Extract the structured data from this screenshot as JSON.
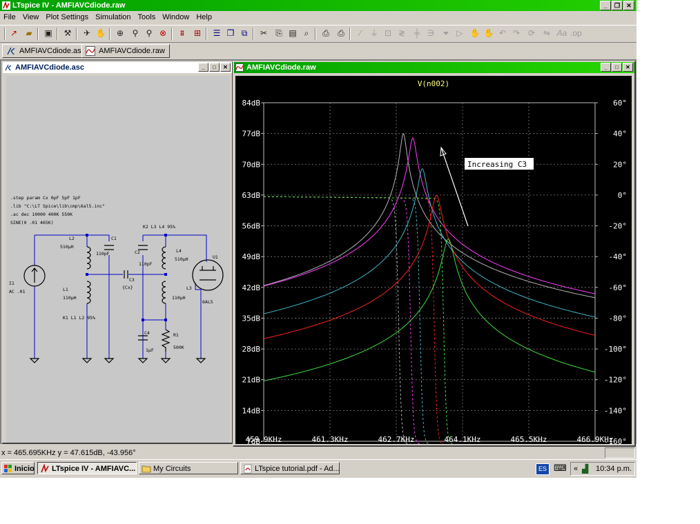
{
  "app": {
    "title": "LTspice IV - AMFIAVCdiode.raw",
    "window_controls": [
      "_",
      "❐",
      "✕"
    ]
  },
  "menu": [
    "File",
    "View",
    "Plot Settings",
    "Simulation",
    "Tools",
    "Window",
    "Help"
  ],
  "toolbar_icons": [
    "new-schematic-icon",
    "open-icon",
    "save-icon",
    "hammer-icon",
    "run-icon",
    "halt-icon",
    "zoom-area-icon",
    "zoom-in-icon",
    "zoom-out-icon",
    "zoom-cancel-icon",
    "autorange-icon",
    "grid-icon",
    "tile-horizontal-icon",
    "cascade-icon",
    "close-windows-icon",
    "cut-icon",
    "copy-icon",
    "paste-icon",
    "find-icon",
    "print-icon",
    "print-setup-icon",
    "wire-icon",
    "ground-icon",
    "label-icon",
    "resistor-icon",
    "capacitor-icon",
    "inductor-icon",
    "diode-icon",
    "component-icon",
    "move-icon",
    "drag-icon",
    "undo-icon",
    "redo-icon",
    "rotate-icon",
    "mirror-icon",
    "text-icon",
    "spice-directive-icon"
  ],
  "doc_tabs": [
    {
      "label": "AMFIAVCdiode.asc",
      "icon": "schematic-icon"
    },
    {
      "label": "AMFIAVCdiode.raw",
      "icon": "waveform-icon"
    }
  ],
  "schematic": {
    "title": "AMFIAVCdiode.asc",
    "directives": [
      ".step param Cx 0pF 5pF 1pF",
      ".lib \"C:\\LT Spice\\lib\\cmp\\6al5.inc\"",
      ".ac dec 10000 400K 550K",
      "SINE(0 .01 465K)"
    ],
    "labels": {
      "i1": "I1",
      "i1_val": "AC .01",
      "l2": "L2",
      "l2_val": "510µH",
      "c1": "C1",
      "c1_val": "110pF",
      "l1": "L1",
      "l1_val": "110µH",
      "k1": "K1 L1 L2 95%",
      "c3": "C3",
      "c3_val": "{Cx}",
      "k2": "K2 L3 L4 95%",
      "c2": "C2",
      "c2_val": "110pF",
      "l4": "L4",
      "l4_val": "510µH",
      "l3": "L3",
      "l3_val": "110µH",
      "u1": "U1",
      "u1_val": "6AL5",
      "c4": "C4",
      "c4_val": "1µF",
      "r1": "R1",
      "r1_val": "500K"
    }
  },
  "waveform": {
    "title": "AMFIAVCdiode.raw",
    "annotation": "Increasing C3"
  },
  "chart_data": {
    "type": "line",
    "title": "V(n002)",
    "x_tick_labels": [
      "459.9KHz",
      "461.3KHz",
      "462.7KHz",
      "464.1KHz",
      "465.5KHz",
      "466.9KHz"
    ],
    "xlim": [
      459.9,
      466.9
    ],
    "y_left_tick_labels": [
      "84dB",
      "77dB",
      "70dB",
      "63dB",
      "56dB",
      "49dB",
      "42dB",
      "35dB",
      "28dB",
      "21dB",
      "14dB",
      "7dB"
    ],
    "ylim_left": [
      7,
      84
    ],
    "y_right_tick_labels": [
      "60°",
      "40°",
      "20°",
      "0°",
      "-20°",
      "-40°",
      "-60°",
      "-80°",
      "-100°",
      "-120°",
      "-140°",
      "-160°"
    ],
    "ylim_right": [
      -160,
      60
    ],
    "grid": true,
    "series": [
      {
        "color": "#b4b4b4",
        "peak_freq": 462.85,
        "peak_db": 77,
        "left_db": 27,
        "right_db": 13,
        "phase_step": 462.75
      },
      {
        "color": "#ff40ff",
        "peak_freq": 463.05,
        "peak_db": 76,
        "left_db": 24.5,
        "right_db": 22.5,
        "phase_step": 463.0
      },
      {
        "color": "#40b4c8",
        "peak_freq": 463.25,
        "peak_db": 69,
        "left_db": 21,
        "right_db": 24.5,
        "phase_step": 463.2
      },
      {
        "color": "#ff2020",
        "peak_freq": 463.55,
        "peak_db": 63,
        "left_db": 17,
        "right_db": 20.5,
        "phase_step": 463.5
      },
      {
        "color": "#40e040",
        "peak_freq": 463.8,
        "peak_db": 53,
        "left_db": 10.5,
        "right_db": 16,
        "phase_step": 463.7
      }
    ]
  },
  "status": {
    "cursor": "x = 465.695KHz   y = 47.615dB, -43.956°"
  },
  "taskbar": {
    "start": "Inicio",
    "tasks": [
      "LTspice IV - AMFIAVC...",
      "My Circuits",
      "LTspice tutorial.pdf - Ad..."
    ],
    "lang": "ES",
    "tray_arrows": "«",
    "clock": "10:34 p.m."
  }
}
